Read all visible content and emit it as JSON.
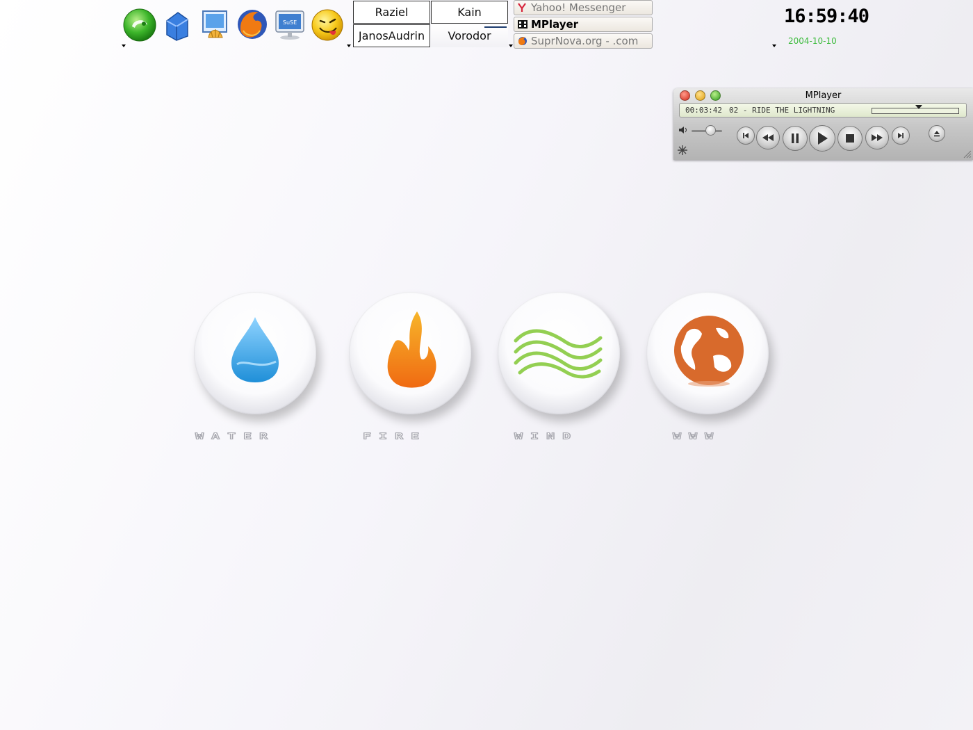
{
  "panel": {
    "quick_launch": [
      {
        "name": "suse-menu-icon"
      },
      {
        "name": "home-folder-icon"
      },
      {
        "name": "control-center-icon"
      },
      {
        "name": "firefox-icon"
      },
      {
        "name": "suse-monitor-icon"
      },
      {
        "name": "smiley-messenger-icon"
      }
    ],
    "desktops": [
      "Raziel",
      "Kain",
      "JanosAudrin",
      "Vorodor"
    ],
    "active_desktop": "Vorodor",
    "tasks": [
      {
        "label": "Yahoo! Messenger",
        "current": false
      },
      {
        "label": "MPlayer",
        "current": true
      },
      {
        "label": "SuprNova.org - .com",
        "current": false
      }
    ],
    "clock": "16:59:40",
    "date": "2004-10-10"
  },
  "mplayer": {
    "title": "MPlayer",
    "elapsed": "00:03:42",
    "track": "02 - RIDE THE LIGHTNING",
    "accent": "#3dbb3d"
  },
  "launchers": [
    {
      "label": "WATER",
      "icon": "water-drop-icon",
      "color": "#3aa8e6"
    },
    {
      "label": "FIRE",
      "icon": "flame-icon",
      "color": "#f59a1a"
    },
    {
      "label": "WIND",
      "icon": "wind-waves-icon",
      "color": "#8fcf4a"
    },
    {
      "label": "WWW",
      "icon": "globe-icon",
      "color": "#d8692c"
    }
  ]
}
